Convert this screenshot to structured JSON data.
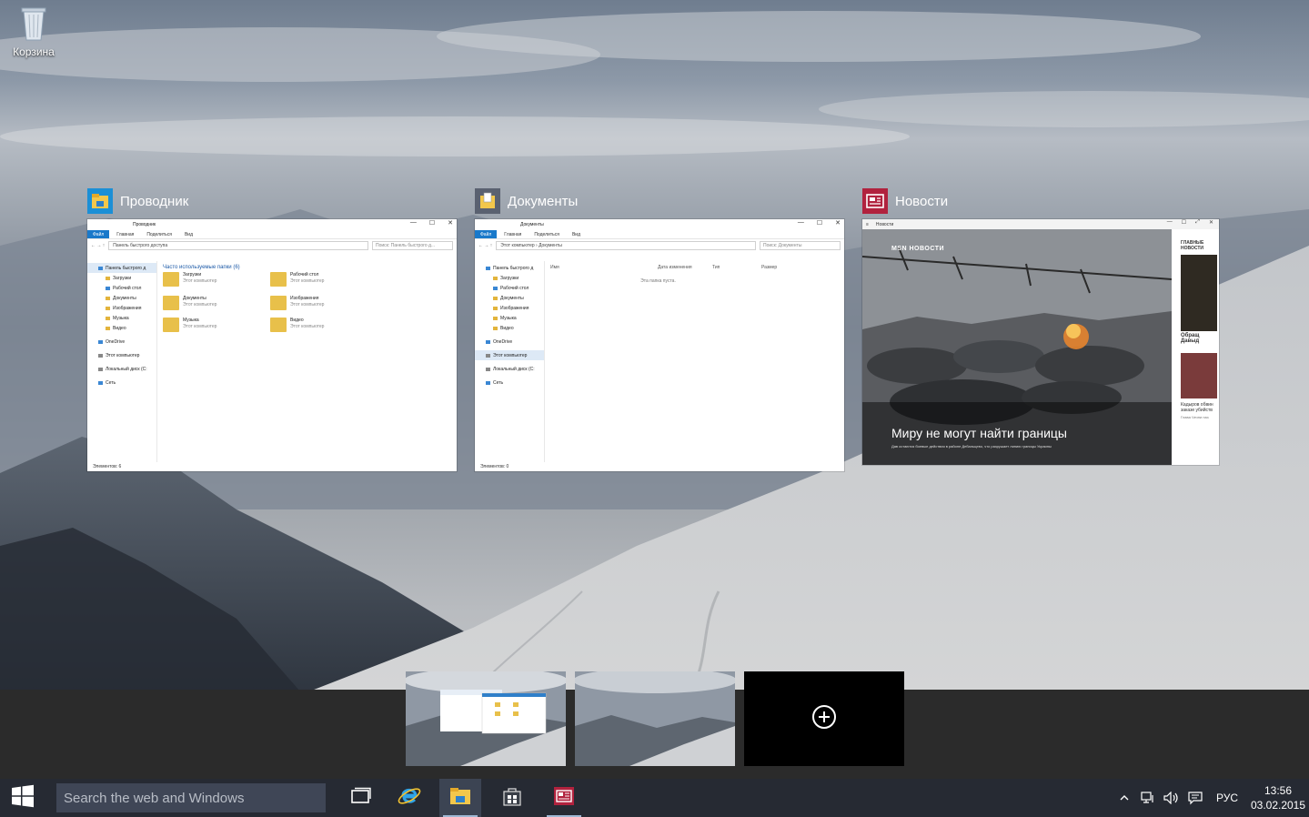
{
  "desktop": {
    "icons": [
      {
        "label": "Корзина",
        "icon": "recycle-bin-icon"
      }
    ]
  },
  "task_view": {
    "windows": [
      {
        "title": "Проводник",
        "icon": "file-explorer-icon",
        "thumb": {
          "titlebar": "Проводник",
          "ribbon": {
            "file": "Файл",
            "tabs": [
              "Главная",
              "Поделиться",
              "Вид"
            ]
          },
          "address": "Панель быстрого доступа",
          "search_placeholder": "Поиск: Панель быстрого д...",
          "nav": [
            "Панель быстрого д",
            "Загрузки",
            "Рабочий стол",
            "Документы",
            "Изображения",
            "Музыка",
            "Видео",
            "OneDrive",
            "Этот компьютер",
            "Локальный диск (C:",
            "Сеть"
          ],
          "group_header": "Часто используемые папки (6)",
          "tiles": [
            {
              "name": "Загрузки",
              "sub": "Этот компьютер"
            },
            {
              "name": "Рабочий стол",
              "sub": "Этот компьютер"
            },
            {
              "name": "Документы",
              "sub": "Этот компьютер"
            },
            {
              "name": "Изображения",
              "sub": "Этот компьютер"
            },
            {
              "name": "Музыка",
              "sub": "Этот компьютер"
            },
            {
              "name": "Видео",
              "sub": "Этот компьютер"
            }
          ],
          "status": "Элементов: 6"
        }
      },
      {
        "title": "Документы",
        "icon": "documents-folder-icon",
        "thumb": {
          "titlebar": "Документы",
          "ribbon": {
            "file": "Файл",
            "tabs": [
              "Главная",
              "Поделиться",
              "Вид"
            ]
          },
          "address": "Этот компьютер › Документы",
          "search_placeholder": "Поиск: Документы",
          "nav": [
            "Панель быстрого д",
            "Загрузки",
            "Рабочий стол",
            "Документы",
            "Изображения",
            "Музыка",
            "Видео",
            "OneDrive",
            "Этот компьютер",
            "Локальный диск (C:",
            "Сеть"
          ],
          "columns": [
            "Имя",
            "Дата изменения",
            "Тип",
            "Размер"
          ],
          "empty_text": "Эта папка пуста.",
          "status": "Элементов: 0"
        }
      },
      {
        "title": "Новости",
        "icon": "news-app-icon",
        "thumb": {
          "titlebar": "Новости",
          "brand": "MSN НОВОСТИ",
          "headline": "Миру не могут найти границы",
          "sub": "Дав остаются боевые действия в районе Дебальцево, что разрушает линию границы Украины",
          "side_header": "ГЛАВНЫЕ НОВОСТИ",
          "side_items": [
            "Обращ Давыд",
            "Кадыров обвин заказе убийств"
          ],
          "side_sub": "Глава Чечни наз"
        }
      }
    ]
  },
  "desktops_strip": {
    "thumbs": [
      "desktop-1",
      "desktop-2"
    ],
    "add_icon": "plus-circle-icon"
  },
  "taskbar": {
    "start_icon": "windows-logo-icon",
    "search_placeholder": "Search the web and Windows",
    "apps": [
      {
        "name": "task-view",
        "icon": "task-view-icon"
      },
      {
        "name": "internet-explorer",
        "icon": "ie-icon"
      },
      {
        "name": "file-explorer",
        "icon": "file-explorer-icon",
        "active": true
      },
      {
        "name": "store",
        "icon": "store-icon"
      },
      {
        "name": "news",
        "icon": "news-app-icon",
        "active": true
      }
    ],
    "tray": {
      "icons": [
        "chevron-up-icon",
        "network-icon",
        "volume-icon",
        "action-center-icon"
      ],
      "language": "РУС",
      "time": "13:56",
      "date": "03.02.2015"
    }
  }
}
